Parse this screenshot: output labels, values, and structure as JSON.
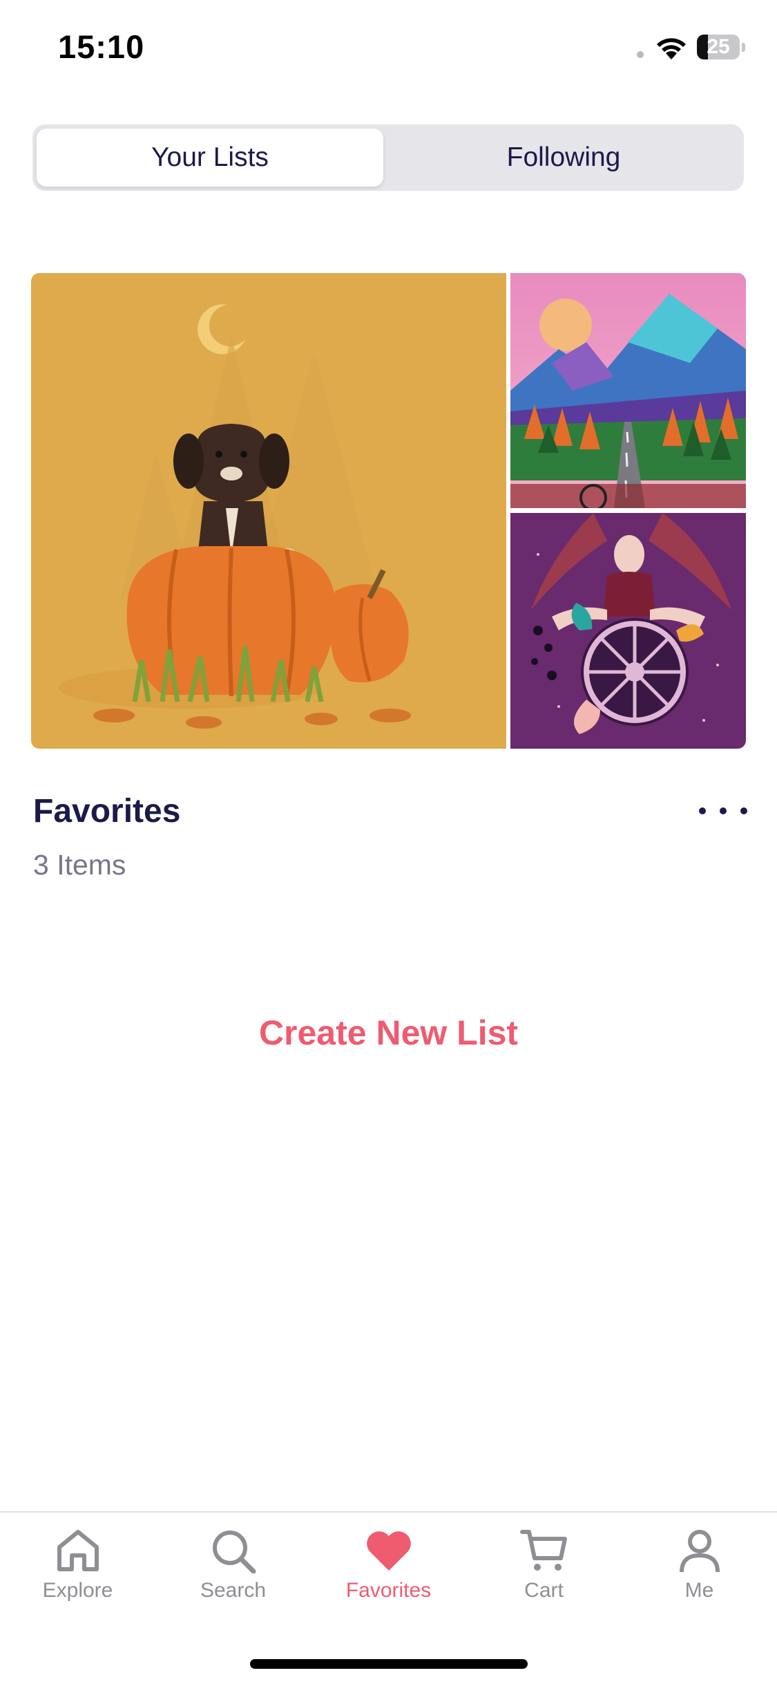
{
  "status_bar": {
    "time": "15:10",
    "battery_level": "25",
    "battery_fraction": 0.25
  },
  "segmented_control": {
    "active": "Your Lists",
    "options": [
      "Your Lists",
      "Following"
    ]
  },
  "list": {
    "title": "Favorites",
    "count_label": "3 Items",
    "artworks": [
      {
        "icon": "dog-in-pumpkin-artwork"
      },
      {
        "icon": "mountain-road-artwork"
      },
      {
        "icon": "wheel-of-fortune-artwork"
      }
    ],
    "more_icon": "ellipsis-icon"
  },
  "create_list_label": "Create New List",
  "tab_bar": {
    "active": "Favorites",
    "items": [
      {
        "label": "Explore",
        "icon": "home-icon"
      },
      {
        "label": "Search",
        "icon": "search-icon"
      },
      {
        "label": "Favorites",
        "icon": "heart-icon"
      },
      {
        "label": "Cart",
        "icon": "cart-icon"
      },
      {
        "label": "Me",
        "icon": "person-icon"
      }
    ]
  },
  "colors": {
    "accent": "#ef5b6f",
    "text_primary": "#1c1a4a",
    "text_secondary": "#77758e",
    "tab_inactive": "#8e8e93"
  }
}
